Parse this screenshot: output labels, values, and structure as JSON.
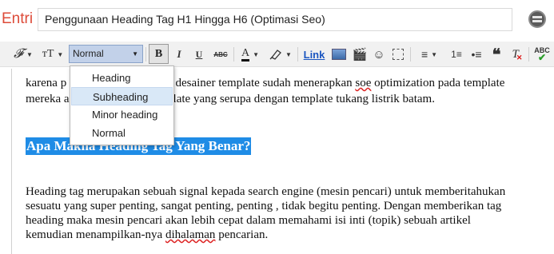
{
  "header": {
    "entri_label": "Entri",
    "post_title": "Penggunaan Heading Tag H1 Hingga H6 (Optimasi Seo)",
    "avatar_icon": "blogger-profile-icon"
  },
  "toolbar": {
    "font_icon": "𝓕",
    "size_icon": "ᴛT",
    "format_value": "Normal",
    "bold": "B",
    "italic": "I",
    "underline": "U",
    "strike": "ABC",
    "text_color": "A",
    "link": "Link",
    "video_glyph": "🎬",
    "emoji_glyph": "☺",
    "align_glyph": "≡",
    "ol_glyph": "1≡",
    "ul_glyph": "•≡",
    "quote_glyph": "❝",
    "clear_glyph": "T",
    "spell_text": "ABC"
  },
  "format_menu": {
    "options": [
      "Heading",
      "Subheading",
      "Minor heading",
      "Normal"
    ],
    "highlighted": "Subheading"
  },
  "content": {
    "line1_start": "karena p",
    "line1_end": "o desainer template sudah menerapkan ",
    "line1_sq": "soe",
    "line1_rest": " optimization pada template",
    "line2_start": "mereka a",
    "line2_end": "late yang serupa dengan template tukang listrik batam.",
    "heading": "Apa Makna Heading Tag Yang Benar?",
    "para_lines": [
      "Heading tag merupakan sebuah signal kepada search engine (mesin pencari) untuk memberitahukan",
      "sesuatu yang super penting, sangat penting, penting , tidak begitu penting. Dengan memberikan tag",
      "heading maka mesin pencari akan lebih cepat dalam memahami isi inti (topik) sebuah artikel"
    ],
    "last_line_start": "kemudian menampilkan-nya ",
    "last_line_sq": "dihalaman",
    "last_line_end": " pencarian."
  }
}
